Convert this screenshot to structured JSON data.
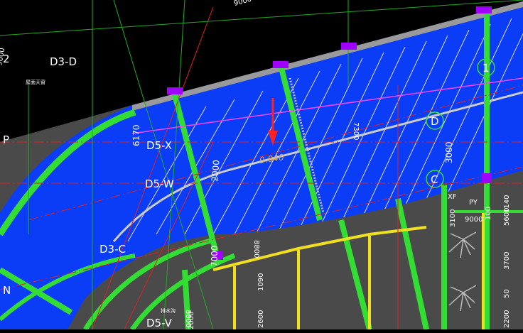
{
  "axis_labels": [
    "2",
    "D3-D",
    "P",
    "D5-X",
    "D5-W",
    "D3-C",
    "N",
    "D5-V"
  ],
  "dimensions": [
    "9000",
    "9000",
    "6170",
    "2000",
    "7000",
    "3000",
    "7300",
    "1090",
    "2600",
    "8800",
    "3700",
    "1140",
    "5600",
    "2200",
    "50",
    "100",
    "3100",
    "2000",
    "8800"
  ],
  "bubbles": [
    "1",
    "D",
    "C"
  ],
  "room_codes": [
    "XF",
    "PY"
  ],
  "elevation": "9.840",
  "tiny_notes": [
    "屋面天窗",
    "排水沟"
  ],
  "colors": {
    "background": "#000000",
    "roof_fill": "#0b3df6",
    "floor_fill": "#4a4a4a",
    "wall": "#33dd33",
    "axis_red": "#e02020",
    "grid_green": "#22aa22",
    "hatch": "#dddddd",
    "column": "#a000ff",
    "wall_yellow": "#f0e020",
    "arrow_red": "#ff2020"
  },
  "icons": [
    "down-arrow-icon",
    "plant-symbol-icon"
  ]
}
